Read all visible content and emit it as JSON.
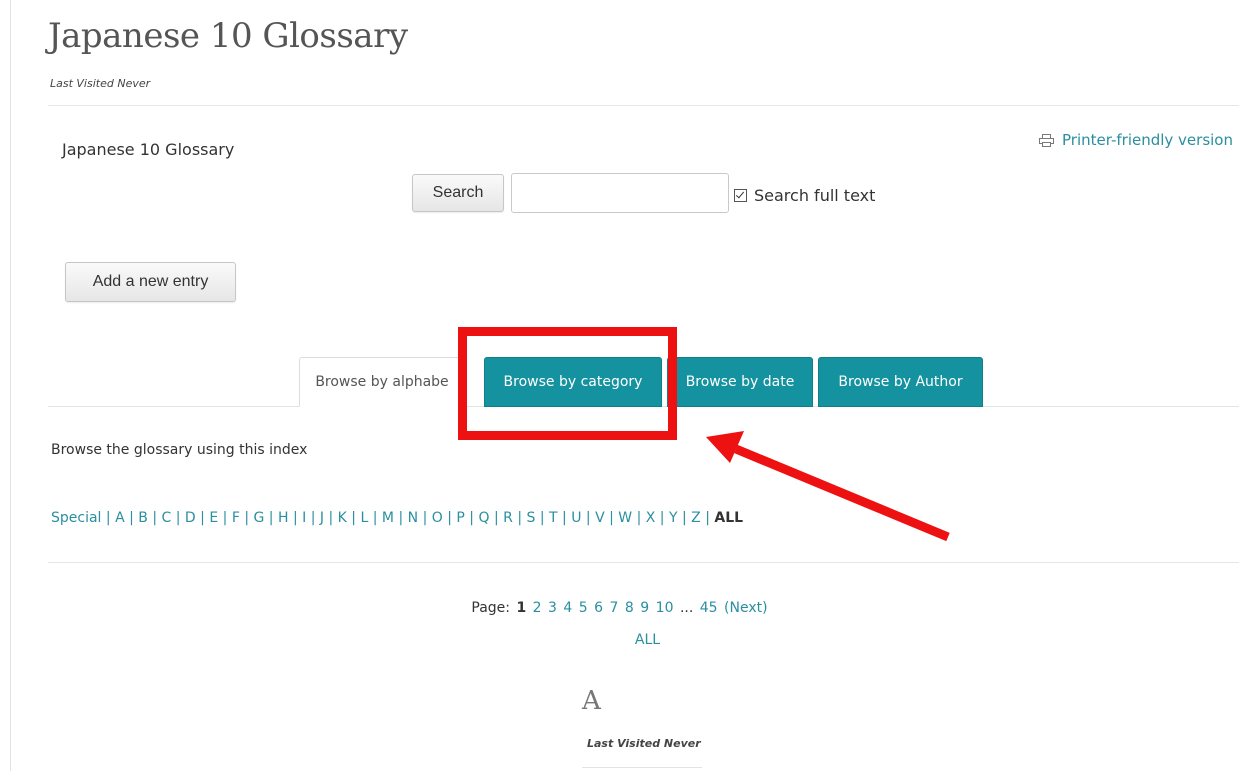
{
  "page": {
    "title": "Japanese 10 Glossary",
    "last_visited": "Last Visited Never"
  },
  "glossary": {
    "name": "Japanese 10 Glossary",
    "printer_link": "Printer-friendly version",
    "search_button": "Search",
    "search_value": "",
    "full_text_label": "Search full text",
    "full_text_checked": true,
    "add_entry_button": "Add a new entry"
  },
  "tabs": [
    {
      "label": "Browse by alphabe",
      "active": true
    },
    {
      "label": "Browse by category",
      "active": false
    },
    {
      "label": "Browse by date",
      "active": false
    },
    {
      "label": "Browse by Author",
      "active": false
    }
  ],
  "browse_index_text": "Browse the glossary using this index",
  "alphabet": [
    "Special",
    "A",
    "B",
    "C",
    "D",
    "E",
    "F",
    "G",
    "H",
    "I",
    "J",
    "K",
    "L",
    "M",
    "N",
    "O",
    "P",
    "Q",
    "R",
    "S",
    "T",
    "U",
    "V",
    "W",
    "X",
    "Y",
    "Z"
  ],
  "alphabet_all": "ALL",
  "pager": {
    "label": "Page:",
    "current": "1",
    "pages": [
      "2",
      "3",
      "4",
      "5",
      "6",
      "7",
      "8",
      "9",
      "10"
    ],
    "ellipsis": "...",
    "last": "45",
    "next": "(Next)",
    "all": "ALL"
  },
  "section": {
    "letter": "A",
    "last_visited": "Last Visited Never"
  },
  "colors": {
    "accent": "#14929f",
    "link": "#2a8fa0",
    "highlight": "#ee1111"
  },
  "icons": {
    "printer": "printer-icon",
    "checkbox": "checkbox-icon",
    "annotation_arrow": "arrow-icon"
  }
}
